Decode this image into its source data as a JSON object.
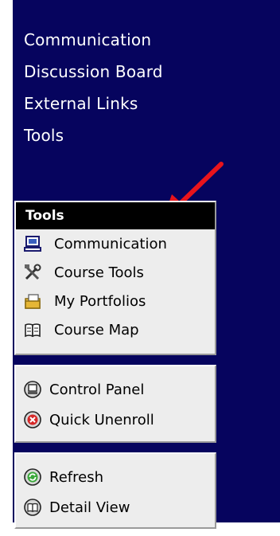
{
  "top_links": [
    "Communication",
    "Discussion Board",
    "External Links",
    "Tools"
  ],
  "tools_box": {
    "header": "Tools",
    "items": [
      {
        "label": "Communication",
        "icon": "computer-icon"
      },
      {
        "label": "Course Tools",
        "icon": "tools-icon"
      },
      {
        "label": "My Portfolios",
        "icon": "portfolio-icon"
      },
      {
        "label": "Course Map",
        "icon": "book-icon"
      }
    ]
  },
  "panel_box": {
    "items": [
      {
        "label": "Control Panel",
        "icon": "control-panel-icon"
      },
      {
        "label": "Quick Unenroll",
        "icon": "unenroll-icon"
      }
    ]
  },
  "view_box": {
    "items": [
      {
        "label": "Refresh",
        "icon": "refresh-icon"
      },
      {
        "label": "Detail View",
        "icon": "detail-view-icon"
      }
    ]
  },
  "colors": {
    "nav_background": "#06045e",
    "box_background": "#ededed",
    "header_background": "#000000",
    "arrow": "#e8141c"
  }
}
